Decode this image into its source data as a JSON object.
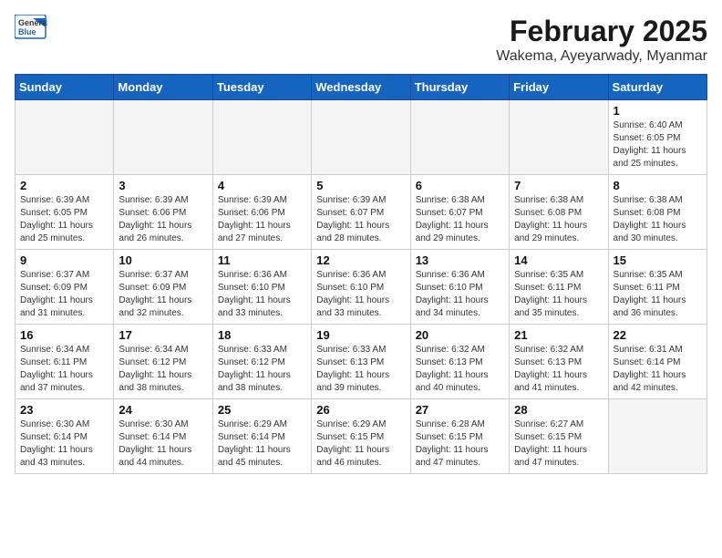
{
  "header": {
    "logo_line1": "General",
    "logo_line2": "Blue",
    "title": "February 2025",
    "subtitle": "Wakema, Ayeyarwady, Myanmar"
  },
  "days_of_week": [
    "Sunday",
    "Monday",
    "Tuesday",
    "Wednesday",
    "Thursday",
    "Friday",
    "Saturday"
  ],
  "weeks": [
    [
      {
        "day": "",
        "info": "",
        "empty": true
      },
      {
        "day": "",
        "info": "",
        "empty": true
      },
      {
        "day": "",
        "info": "",
        "empty": true
      },
      {
        "day": "",
        "info": "",
        "empty": true
      },
      {
        "day": "",
        "info": "",
        "empty": true
      },
      {
        "day": "",
        "info": "",
        "empty": true
      },
      {
        "day": "1",
        "info": "Sunrise: 6:40 AM\nSunset: 6:05 PM\nDaylight: 11 hours\nand 25 minutes."
      }
    ],
    [
      {
        "day": "2",
        "info": "Sunrise: 6:39 AM\nSunset: 6:05 PM\nDaylight: 11 hours\nand 25 minutes."
      },
      {
        "day": "3",
        "info": "Sunrise: 6:39 AM\nSunset: 6:06 PM\nDaylight: 11 hours\nand 26 minutes."
      },
      {
        "day": "4",
        "info": "Sunrise: 6:39 AM\nSunset: 6:06 PM\nDaylight: 11 hours\nand 27 minutes."
      },
      {
        "day": "5",
        "info": "Sunrise: 6:39 AM\nSunset: 6:07 PM\nDaylight: 11 hours\nand 28 minutes."
      },
      {
        "day": "6",
        "info": "Sunrise: 6:38 AM\nSunset: 6:07 PM\nDaylight: 11 hours\nand 29 minutes."
      },
      {
        "day": "7",
        "info": "Sunrise: 6:38 AM\nSunset: 6:08 PM\nDaylight: 11 hours\nand 29 minutes."
      },
      {
        "day": "8",
        "info": "Sunrise: 6:38 AM\nSunset: 6:08 PM\nDaylight: 11 hours\nand 30 minutes."
      }
    ],
    [
      {
        "day": "9",
        "info": "Sunrise: 6:37 AM\nSunset: 6:09 PM\nDaylight: 11 hours\nand 31 minutes."
      },
      {
        "day": "10",
        "info": "Sunrise: 6:37 AM\nSunset: 6:09 PM\nDaylight: 11 hours\nand 32 minutes."
      },
      {
        "day": "11",
        "info": "Sunrise: 6:36 AM\nSunset: 6:10 PM\nDaylight: 11 hours\nand 33 minutes."
      },
      {
        "day": "12",
        "info": "Sunrise: 6:36 AM\nSunset: 6:10 PM\nDaylight: 11 hours\nand 33 minutes."
      },
      {
        "day": "13",
        "info": "Sunrise: 6:36 AM\nSunset: 6:10 PM\nDaylight: 11 hours\nand 34 minutes."
      },
      {
        "day": "14",
        "info": "Sunrise: 6:35 AM\nSunset: 6:11 PM\nDaylight: 11 hours\nand 35 minutes."
      },
      {
        "day": "15",
        "info": "Sunrise: 6:35 AM\nSunset: 6:11 PM\nDaylight: 11 hours\nand 36 minutes."
      }
    ],
    [
      {
        "day": "16",
        "info": "Sunrise: 6:34 AM\nSunset: 6:11 PM\nDaylight: 11 hours\nand 37 minutes."
      },
      {
        "day": "17",
        "info": "Sunrise: 6:34 AM\nSunset: 6:12 PM\nDaylight: 11 hours\nand 38 minutes."
      },
      {
        "day": "18",
        "info": "Sunrise: 6:33 AM\nSunset: 6:12 PM\nDaylight: 11 hours\nand 38 minutes."
      },
      {
        "day": "19",
        "info": "Sunrise: 6:33 AM\nSunset: 6:13 PM\nDaylight: 11 hours\nand 39 minutes."
      },
      {
        "day": "20",
        "info": "Sunrise: 6:32 AM\nSunset: 6:13 PM\nDaylight: 11 hours\nand 40 minutes."
      },
      {
        "day": "21",
        "info": "Sunrise: 6:32 AM\nSunset: 6:13 PM\nDaylight: 11 hours\nand 41 minutes."
      },
      {
        "day": "22",
        "info": "Sunrise: 6:31 AM\nSunset: 6:14 PM\nDaylight: 11 hours\nand 42 minutes."
      }
    ],
    [
      {
        "day": "23",
        "info": "Sunrise: 6:30 AM\nSunset: 6:14 PM\nDaylight: 11 hours\nand 43 minutes."
      },
      {
        "day": "24",
        "info": "Sunrise: 6:30 AM\nSunset: 6:14 PM\nDaylight: 11 hours\nand 44 minutes."
      },
      {
        "day": "25",
        "info": "Sunrise: 6:29 AM\nSunset: 6:14 PM\nDaylight: 11 hours\nand 45 minutes."
      },
      {
        "day": "26",
        "info": "Sunrise: 6:29 AM\nSunset: 6:15 PM\nDaylight: 11 hours\nand 46 minutes."
      },
      {
        "day": "27",
        "info": "Sunrise: 6:28 AM\nSunset: 6:15 PM\nDaylight: 11 hours\nand 47 minutes."
      },
      {
        "day": "28",
        "info": "Sunrise: 6:27 AM\nSunset: 6:15 PM\nDaylight: 11 hours\nand 47 minutes."
      },
      {
        "day": "",
        "info": "",
        "empty": true
      }
    ]
  ]
}
